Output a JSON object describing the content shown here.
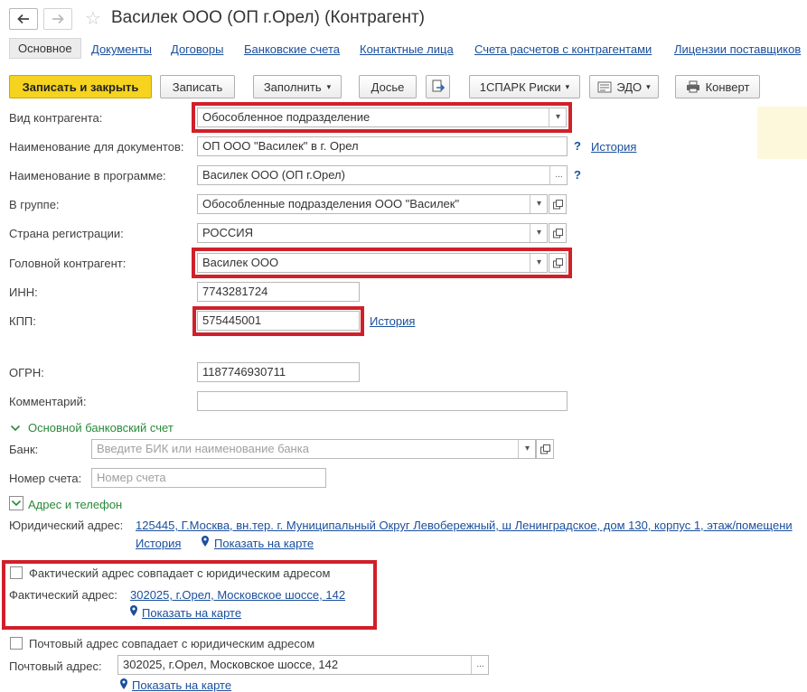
{
  "header": {
    "title": "Василек ООО (ОП г.Орел) (Контрагент)"
  },
  "tabs": [
    {
      "label": "Основное"
    },
    {
      "label": "Документы"
    },
    {
      "label": "Договоры"
    },
    {
      "label": "Банковские счета"
    },
    {
      "label": "Контактные лица"
    },
    {
      "label": "Счета расчетов с контрагентами"
    },
    {
      "label": "Лицензии поставщиков"
    }
  ],
  "toolbar": {
    "save_close": "Записать и закрыть",
    "save": "Записать",
    "fill": "Заполнить",
    "dossier": "Досье",
    "spark": "1СПАРК Риски",
    "edo": "ЭДО",
    "envelope": "Конверт"
  },
  "form": {
    "kind_label": "Вид контрагента:",
    "kind_value": "Обособленное подразделение",
    "docname_label": "Наименование для документов:",
    "docname_value": "ОП ООО \"Василек\" в г. Орел",
    "history": "История",
    "progname_label": "Наименование в программе:",
    "progname_value": "Василек ООО (ОП г.Орел)",
    "qmark": "?",
    "group_label": "В группе:",
    "group_value": "Обособленные подразделения ООО \"Василек\"",
    "country_label": "Страна регистрации:",
    "country_value": "РОССИЯ",
    "parent_label": "Головной контрагент:",
    "parent_value": "Василек ООО",
    "inn_label": "ИНН:",
    "inn_value": "7743281724",
    "kpp_label": "КПП:",
    "kpp_value": "575445001",
    "ogrn_label": "ОГРН:",
    "ogrn_value": "1187746930711",
    "comment_label": "Комментарий:",
    "comment_value": "",
    "ellipsis": "...",
    "dropdown": "▾"
  },
  "bank": {
    "section": "Основной банковский счет",
    "bank_label": "Банк:",
    "bank_placeholder": "Введите БИК или наименование банка",
    "account_label": "Номер счета:",
    "account_placeholder": "Номер счета"
  },
  "address": {
    "section": "Адрес и телефон",
    "legal_label": "Юридический адрес:",
    "legal_value": "125445, Г.Москва, вн.тер. г. Муниципальный Округ Левобережный, ш Ленинградское, дом 130, корпус 1, этаж/помещени",
    "history": "История",
    "show_map": "Показать на карте",
    "actual_same": "Фактический адрес совпадает с юридическим адресом",
    "actual_label": "Фактический адрес:",
    "actual_value": "302025, г.Орел, Московское шоссе, 142",
    "postal_same": "Почтовый адрес совпадает с юридическим адресом",
    "postal_label": "Почтовый адрес:",
    "postal_value": "302025, г.Орел, Московское шоссе, 142"
  },
  "colors": {
    "highlight": "#d0202a",
    "link": "#1a4f9c",
    "section": "#2a8a3a",
    "primary_button": "#f5d31e"
  }
}
